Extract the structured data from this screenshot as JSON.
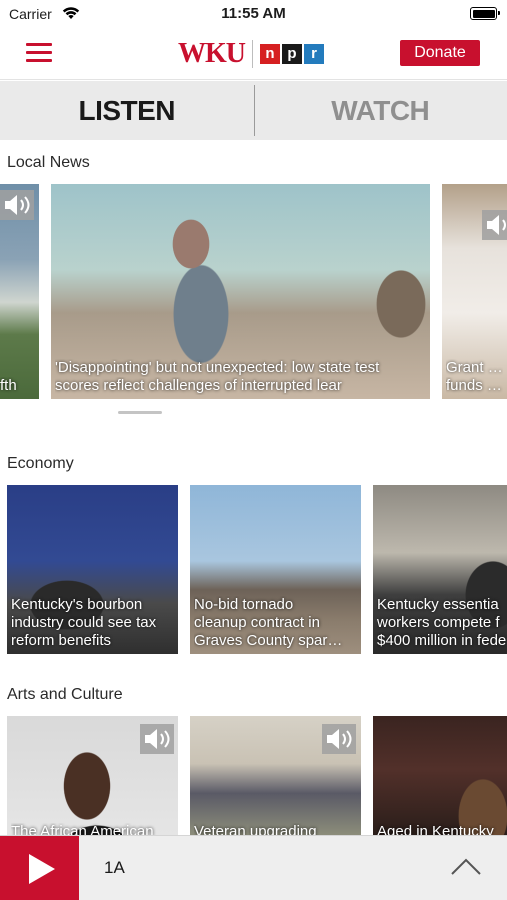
{
  "status": {
    "carrier": "Carrier",
    "time": "11:55 AM"
  },
  "header": {
    "donate_label": "Donate",
    "logo_text": "WKU",
    "npr_letters": [
      "n",
      "p",
      "r"
    ]
  },
  "tabs": [
    {
      "label": "LISTEN",
      "active": true
    },
    {
      "label": "WATCH",
      "active": false
    }
  ],
  "sections": {
    "local_news": {
      "title": "Local News",
      "cards": [
        {
          "caption_lines": [
            "fth"
          ],
          "audio": true
        },
        {
          "caption_lines": [
            "'Disappointing' but not unexpected: low state test",
            "scores reflect challenges of interrupted lear"
          ],
          "audio": false
        },
        {
          "caption_lines": [
            "Grant ap",
            "funds are"
          ],
          "audio": true
        }
      ]
    },
    "economy": {
      "title": "Economy",
      "cards": [
        {
          "caption_lines": [
            "Kentucky's bourbon",
            "industry could see tax",
            "reform benefits"
          ]
        },
        {
          "caption_lines": [
            "No-bid tornado",
            "cleanup contract in",
            "Graves County spar…"
          ]
        },
        {
          "caption_lines": [
            "Kentucky essentia",
            "workers compete f",
            "$400 million in fede"
          ]
        }
      ]
    },
    "arts_culture": {
      "title": "Arts and Culture",
      "cards": [
        {
          "caption_lines": [
            "The African American"
          ],
          "audio": true
        },
        {
          "caption_lines": [
            "Veteran upgrading"
          ],
          "audio": true
        },
        {
          "caption_lines": [
            "Aged in Kentucky"
          ],
          "audio": false
        }
      ]
    }
  },
  "player": {
    "now_playing": "1A"
  },
  "colors": {
    "brand_red": "#c8102e",
    "tab_bg": "#eaeaea",
    "player_bg": "#eeeeee"
  }
}
